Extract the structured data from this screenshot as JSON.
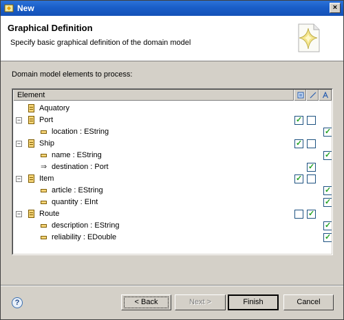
{
  "window": {
    "title": "New"
  },
  "banner": {
    "title": "Graphical Definition",
    "description": "Specify basic graphical definition of the domain model"
  },
  "body": {
    "label": "Domain model elements to process:"
  },
  "tree": {
    "header": {
      "element": "Element"
    },
    "rows": [
      {
        "label": "Aquatory",
        "kind": "class",
        "level": 0,
        "expander": "",
        "checks": [
          false,
          false,
          false
        ],
        "show": [
          false,
          false,
          false
        ]
      },
      {
        "label": "Port",
        "kind": "class",
        "level": 0,
        "expander": "−",
        "checks": [
          true,
          false,
          false
        ],
        "show": [
          true,
          true,
          false
        ]
      },
      {
        "label": "location : EString",
        "kind": "attribute",
        "level": 1,
        "expander": "",
        "checks": [
          false,
          false,
          true
        ],
        "show": [
          false,
          false,
          true
        ]
      },
      {
        "label": "Ship",
        "kind": "class",
        "level": 0,
        "expander": "−",
        "checks": [
          true,
          false,
          false
        ],
        "show": [
          true,
          true,
          false
        ]
      },
      {
        "label": "name : EString",
        "kind": "attribute",
        "level": 1,
        "expander": "",
        "checks": [
          false,
          false,
          true
        ],
        "show": [
          false,
          false,
          true
        ]
      },
      {
        "label": "destination : Port",
        "kind": "reference",
        "level": 1,
        "expander": "",
        "checks": [
          false,
          true,
          false
        ],
        "show": [
          false,
          true,
          false
        ]
      },
      {
        "label": "Item",
        "kind": "class",
        "level": 0,
        "expander": "−",
        "checks": [
          true,
          false,
          false
        ],
        "show": [
          true,
          true,
          false
        ]
      },
      {
        "label": "article : EString",
        "kind": "attribute",
        "level": 1,
        "expander": "",
        "checks": [
          false,
          false,
          true
        ],
        "show": [
          false,
          false,
          true
        ]
      },
      {
        "label": "quantity : EInt",
        "kind": "attribute",
        "level": 1,
        "expander": "",
        "checks": [
          false,
          false,
          true
        ],
        "show": [
          false,
          false,
          true
        ]
      },
      {
        "label": "Route",
        "kind": "class",
        "level": 0,
        "expander": "−",
        "checks": [
          false,
          true,
          false
        ],
        "show": [
          true,
          true,
          false
        ]
      },
      {
        "label": "description : EString",
        "kind": "attribute",
        "level": 1,
        "expander": "",
        "checks": [
          false,
          false,
          true
        ],
        "show": [
          false,
          false,
          true
        ]
      },
      {
        "label": "reliability : EDouble",
        "kind": "attribute",
        "level": 1,
        "expander": "",
        "checks": [
          false,
          false,
          true
        ],
        "show": [
          false,
          false,
          true
        ]
      }
    ]
  },
  "buttons": {
    "back": "< Back",
    "next": "Next >",
    "finish": "Finish",
    "cancel": "Cancel"
  },
  "icons": {
    "help": "?",
    "close": "×"
  }
}
